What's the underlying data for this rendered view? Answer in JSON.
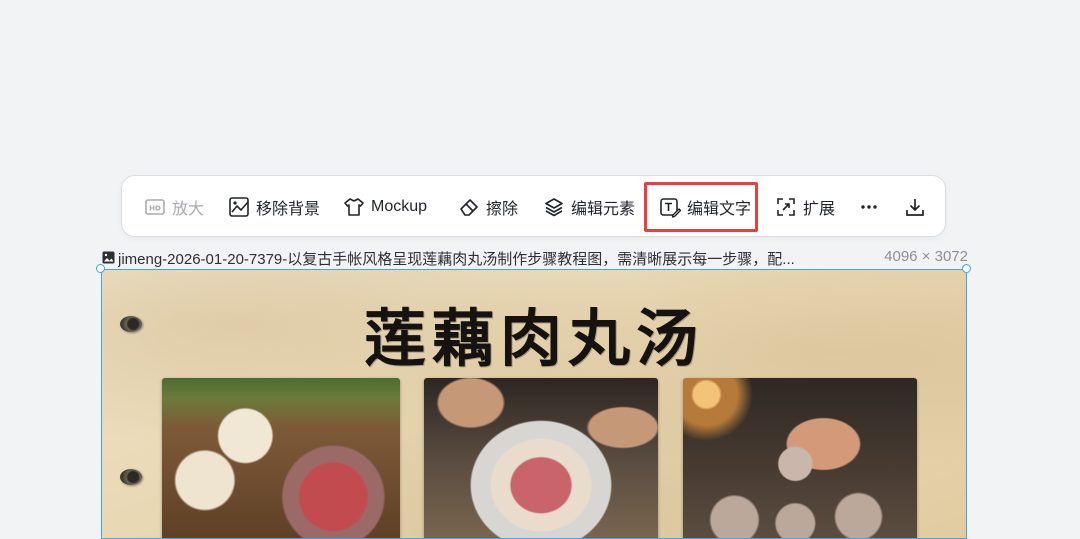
{
  "toolbar": {
    "items": [
      {
        "label": "放大",
        "icon": "hd-icon",
        "disabled": true
      },
      {
        "label": "移除背景",
        "icon": "remove-background-icon"
      },
      {
        "label": "Mockup",
        "icon": "tshirt-icon"
      },
      {
        "label": "擦除",
        "icon": "eraser-icon"
      },
      {
        "label": "编辑元素",
        "icon": "layers-icon"
      },
      {
        "label": "编辑文字",
        "icon": "edit-text-icon",
        "highlighted": true
      },
      {
        "label": "扩展",
        "icon": "expand-icon"
      }
    ],
    "more_icon": "more-icon",
    "download_icon": "download-icon",
    "highlight_color": "#e8403f"
  },
  "image": {
    "filename": "jimeng-2026-01-20-7379-以复古手帐风格呈现莲藕肉丸汤制作步骤教程图，需清晰展示每一步骤，配...",
    "dimensions": "4096 × 3072",
    "title": "莲藕肉丸汤",
    "selection_color": "#3ea5f5"
  }
}
